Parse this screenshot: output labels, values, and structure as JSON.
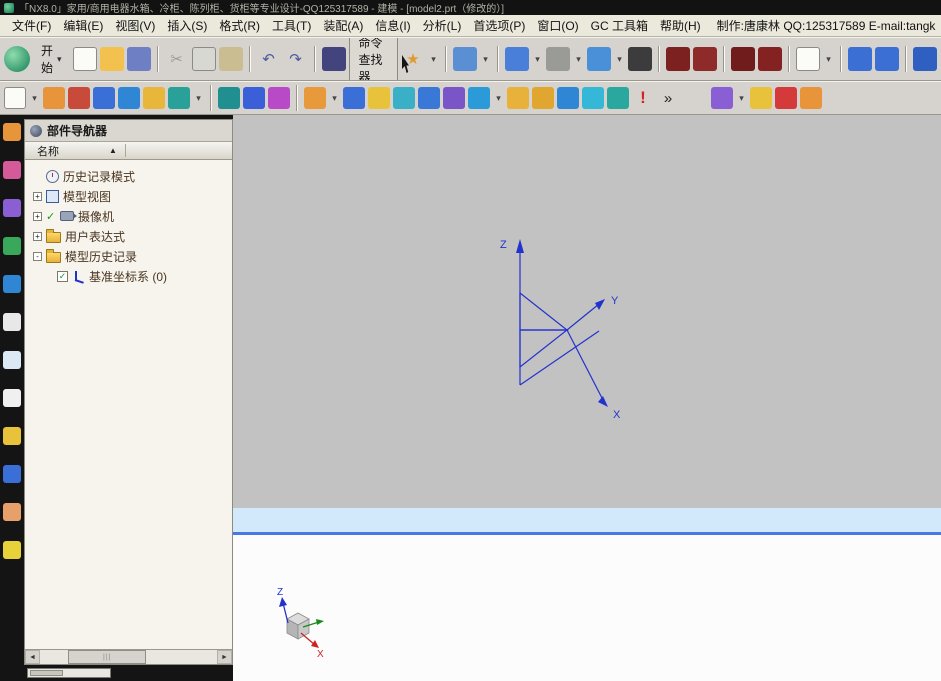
{
  "window": {
    "title": "「NX8.0」家用/商用电器水箱、冷柜、陈列柜、货柜等专业设计-QQ125317589 - 建模 - [model2.prt（修改的）]"
  },
  "menu": {
    "items": [
      "文件(F)",
      "编辑(E)",
      "视图(V)",
      "插入(S)",
      "格式(R)",
      "工具(T)",
      "装配(A)",
      "信息(I)",
      "分析(L)",
      "首选项(P)",
      "窗口(O)",
      "GC 工具箱",
      "帮助(H)"
    ],
    "credit": "制作:唐康林 QQ:125317589 E-mail:tangk"
  },
  "toolbar1": {
    "start_label": "开始",
    "start_caret": "▾",
    "command_finder_label": "命令查找器",
    "group_a": [
      {
        "name": "new-part-icon",
        "bg": "#fbfbf8",
        "cls": "bordered"
      },
      {
        "name": "open-icon",
        "bg": "#f2c14e"
      },
      {
        "name": "save-icon",
        "bg": "#6f7fc4"
      },
      {
        "name": "toolbar-separator",
        "cls": "tb-sep",
        "inter": false
      },
      {
        "name": "cut-icon",
        "glyph": "✂",
        "fg": "#9a9a96"
      },
      {
        "name": "copy-icon",
        "bg": "#d8d8d2",
        "cls": "bordered"
      },
      {
        "name": "paste-icon",
        "bg": "#cbbd92"
      },
      {
        "name": "toolbar-separator",
        "cls": "tb-sep",
        "inter": false
      },
      {
        "name": "undo-icon",
        "glyph": "↶",
        "fg": "#4a5a9e"
      },
      {
        "name": "redo-icon",
        "glyph": "↷",
        "fg": "#4a5a9e"
      },
      {
        "name": "toolbar-separator",
        "cls": "tb-sep",
        "inter": false
      },
      {
        "name": "command-finder-icon",
        "bg": "#43437e"
      }
    ],
    "group_b": [
      {
        "name": "selection-wand-icon",
        "glyph": "★",
        "fg": "#e09a2f"
      },
      {
        "name": "selection-wand-caret",
        "glyph": "▾",
        "cls": "caret"
      },
      {
        "name": "toolbar-separator",
        "cls": "tb-sep",
        "inter": false
      },
      {
        "name": "touch-mode-icon",
        "bg": "#5b8fd4"
      },
      {
        "name": "touch-mode-caret",
        "glyph": "▾",
        "cls": "caret"
      },
      {
        "name": "toolbar-separator",
        "cls": "tb-sep",
        "inter": false
      },
      {
        "name": "true-shading-icon",
        "bg": "#4a7fd9"
      },
      {
        "name": "true-shading-caret",
        "glyph": "▾",
        "cls": "caret"
      },
      {
        "name": "render-style-icon",
        "bg": "#9a9a96"
      },
      {
        "name": "render-style-caret",
        "glyph": "▾",
        "cls": "caret"
      },
      {
        "name": "orient-view-icon",
        "bg": "#4a90d9"
      },
      {
        "name": "orient-view-caret",
        "glyph": "▾",
        "cls": "caret"
      },
      {
        "name": "shaded-sphere-icon",
        "bg": "#3c3c3c"
      },
      {
        "name": "toolbar-separator",
        "cls": "tb-sep",
        "inter": false
      },
      {
        "name": "material-red-icon-1",
        "bg": "#7c2020"
      },
      {
        "name": "material-red-icon-2",
        "bg": "#8e2a2a"
      },
      {
        "name": "toolbar-separator",
        "cls": "tb-sep",
        "inter": false
      },
      {
        "name": "material-red-icon-3",
        "bg": "#701c1c"
      },
      {
        "name": "material-red-icon-4",
        "bg": "#842222"
      },
      {
        "name": "toolbar-separator",
        "cls": "tb-sep",
        "inter": false
      },
      {
        "name": "background-icon",
        "bg": "#fbfbf8",
        "cls": "bordered"
      },
      {
        "name": "background-caret",
        "glyph": "▾",
        "cls": "caret"
      },
      {
        "name": "toolbar-separator",
        "cls": "tb-sep",
        "inter": false
      },
      {
        "name": "window-icon-1",
        "bg": "#3b6fd4"
      },
      {
        "name": "window-icon-2",
        "bg": "#3b6fd4"
      },
      {
        "name": "toolbar-separator",
        "cls": "tb-sep",
        "inter": false
      },
      {
        "name": "overflow-right-icon",
        "bg": "#2f5fc0"
      }
    ]
  },
  "toolbar2": {
    "items": [
      {
        "name": "sketch-dropdown-icon",
        "bg": "#fbfbf8",
        "cls": "bordered"
      },
      {
        "name": "sketch-caret",
        "glyph": "▾",
        "cls": "caret"
      },
      {
        "name": "datum-plane-icon",
        "bg": "#e8943a"
      },
      {
        "name": "datum-csys-icon",
        "bg": "#c84a3a"
      },
      {
        "name": "block-icon",
        "bg": "#3a6fd8"
      },
      {
        "name": "sphere-icon",
        "bg": "#2e86d4"
      },
      {
        "name": "cylinder-icon",
        "bg": "#e8b63a"
      },
      {
        "name": "cone-icon",
        "bg": "#2aa198"
      },
      {
        "name": "primitives-caret",
        "glyph": "▾",
        "cls": "caret"
      },
      {
        "name": "toolbar-separator",
        "cls": "tb-sep",
        "inter": false
      },
      {
        "name": "datum-axis-icon",
        "bg": "#1f8f8f"
      },
      {
        "name": "point-icon",
        "bg": "#3a5fd8"
      },
      {
        "name": "point-set-icon",
        "bg": "#b84ac8"
      },
      {
        "name": "toolbar-separator",
        "cls": "tb-sep",
        "inter": false
      },
      {
        "name": "extrude-icon",
        "bg": "#e8993a"
      },
      {
        "name": "extrude-caret",
        "glyph": "▾",
        "cls": "caret"
      },
      {
        "name": "revolve-icon",
        "bg": "#3a6fd8"
      },
      {
        "name": "sweep-icon",
        "bg": "#e8c23a"
      },
      {
        "name": "tube-icon",
        "bg": "#3ab0c8"
      },
      {
        "name": "unite-icon",
        "bg": "#3a78d8"
      },
      {
        "name": "subtract-icon",
        "bg": "#7a55c8"
      },
      {
        "name": "intersect-icon",
        "bg": "#2a9ad8"
      },
      {
        "name": "feature-caret",
        "glyph": "▾",
        "cls": "caret"
      },
      {
        "name": "edge-blend-icon",
        "bg": "#e8b23a"
      },
      {
        "name": "chamfer-icon",
        "bg": "#e0a62f"
      },
      {
        "name": "ball-blend-icon",
        "bg": "#2e86d4"
      },
      {
        "name": "shell-icon",
        "bg": "#35b8d8"
      },
      {
        "name": "draft-icon",
        "bg": "#2aa8a0"
      },
      {
        "name": "alert-icon",
        "glyph": "!",
        "fg": "#d42222",
        "cls": "glyph-bold"
      },
      {
        "name": "more-commands-icon",
        "glyph": "»",
        "fg": "#222222"
      },
      {
        "name": "toolbar-gap",
        "cls": "tb-gap",
        "inter": false
      },
      {
        "name": "synchronous-modeling-icon",
        "bg": "#8a5fd4"
      },
      {
        "name": "synchronous-caret",
        "glyph": "▾",
        "cls": "caret"
      },
      {
        "name": "measure-icon",
        "bg": "#e8c23a"
      },
      {
        "name": "unsectioned-icon",
        "bg": "#d43a3a"
      },
      {
        "name": "edit-section-icon",
        "bg": "#e8943a"
      }
    ]
  },
  "resource_bar": {
    "items": [
      {
        "name": "navigator-tool-icon",
        "bg": "#e8943a"
      },
      {
        "name": "assembly-navigator-icon",
        "bg": "#d45a9a"
      },
      {
        "name": "constraint-navigator-icon",
        "bg": "#8a5fd4"
      },
      {
        "name": "part-navigator-icon",
        "bg": "#3aa85a"
      },
      {
        "name": "web-browser-icon",
        "bg": "#2e86d4"
      },
      {
        "name": "reuse-library-icon",
        "bg": "#e8e8e8"
      },
      {
        "name": "history-icon",
        "bg": "#dce8f4"
      },
      {
        "name": "process-studio-icon",
        "bg": "#f0f0f0"
      },
      {
        "name": "palette-icon",
        "bg": "#e8c23a"
      },
      {
        "name": "roles-icon",
        "bg": "#3a6fd8"
      },
      {
        "name": "people-icon",
        "bg": "#e8a06a"
      },
      {
        "name": "touch-panel-icon",
        "bg": "#e8d23a"
      }
    ]
  },
  "navigator": {
    "title": "部件导航器",
    "column_header": "名称",
    "sort_indicator": "▲",
    "items": [
      {
        "expander": "",
        "label": "历史记录模式"
      },
      {
        "expander": "+",
        "label": "模型视图"
      },
      {
        "expander": "+",
        "check": "✓",
        "label": "摄像机"
      },
      {
        "expander": "+",
        "label": "用户表达式"
      },
      {
        "expander": "-",
        "label": "模型历史记录"
      },
      {
        "expander": "",
        "label": "基准坐标系 (0)"
      }
    ]
  },
  "viewport": {
    "axis_z": "Z",
    "axis_y": "Y",
    "axis_x": "X",
    "triad_z": "Z",
    "triad_x": "X"
  },
  "colors": {
    "titlebar_bg": "#121212",
    "toolbar_bg": "#d6d3ce",
    "viewport_gray": "#c2c2c2",
    "viewport_band": "#d2e9fb",
    "band_line": "#4a78e8",
    "csys_blue": "#2233cc",
    "axis_x_red": "#cc2222",
    "axis_y_green": "#1a8a1a",
    "tree_text": "#4a3521"
  }
}
